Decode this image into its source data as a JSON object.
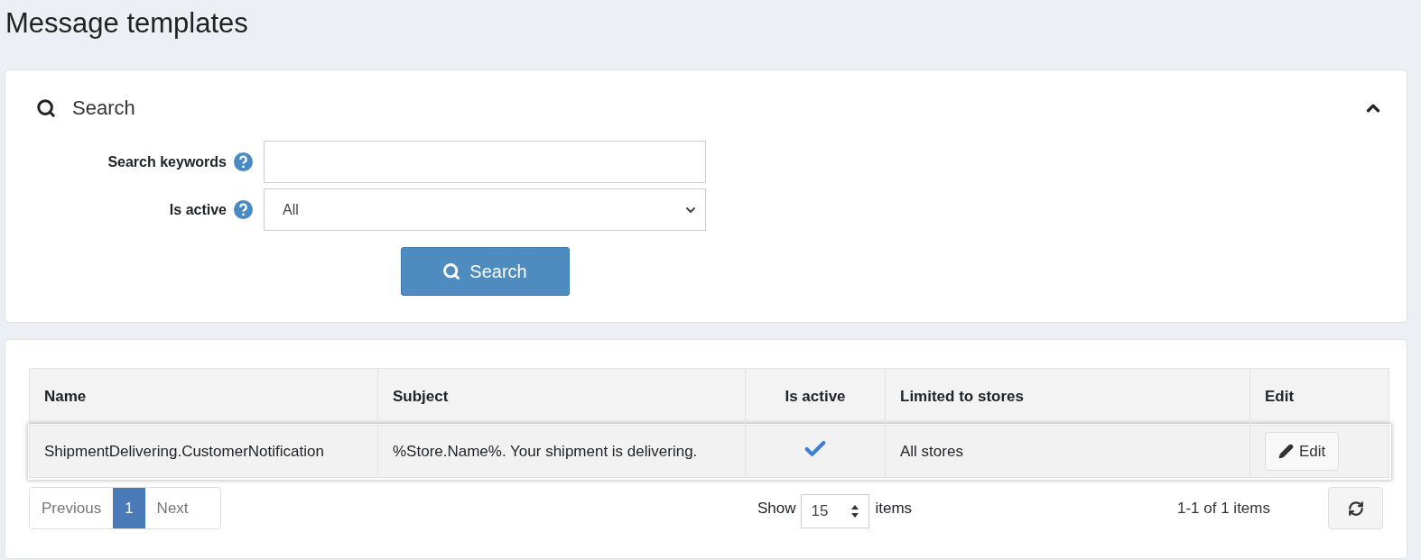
{
  "page_title": "Message templates",
  "search_panel": {
    "title": "Search",
    "expanded": true,
    "fields": [
      {
        "kind": "text",
        "label": "Search keywords"
      },
      {
        "kind": "select",
        "label": "Is active",
        "value": "All"
      }
    ],
    "button": "Search"
  },
  "table": {
    "columns": [
      {
        "label": "Name"
      },
      {
        "label": "Subject"
      },
      {
        "label": "Is active"
      },
      {
        "label": "Limited to stores"
      },
      {
        "label": "Edit"
      }
    ],
    "rows": [
      {
        "name": "ShipmentDelivering.CustomerNotification",
        "subject": "%Store.Name%. Your shipment is delivering.",
        "active": true,
        "stores": "All stores",
        "edit": "Edit",
        "selected": true
      }
    ]
  },
  "pager": {
    "previous": "Previous",
    "pages": [
      {
        "label": "1",
        "selected": true
      }
    ],
    "next": "Next"
  },
  "page_size": {
    "label": "Show",
    "value": "15",
    "suffix": "items"
  },
  "summary": "1-1 of 1 items"
}
